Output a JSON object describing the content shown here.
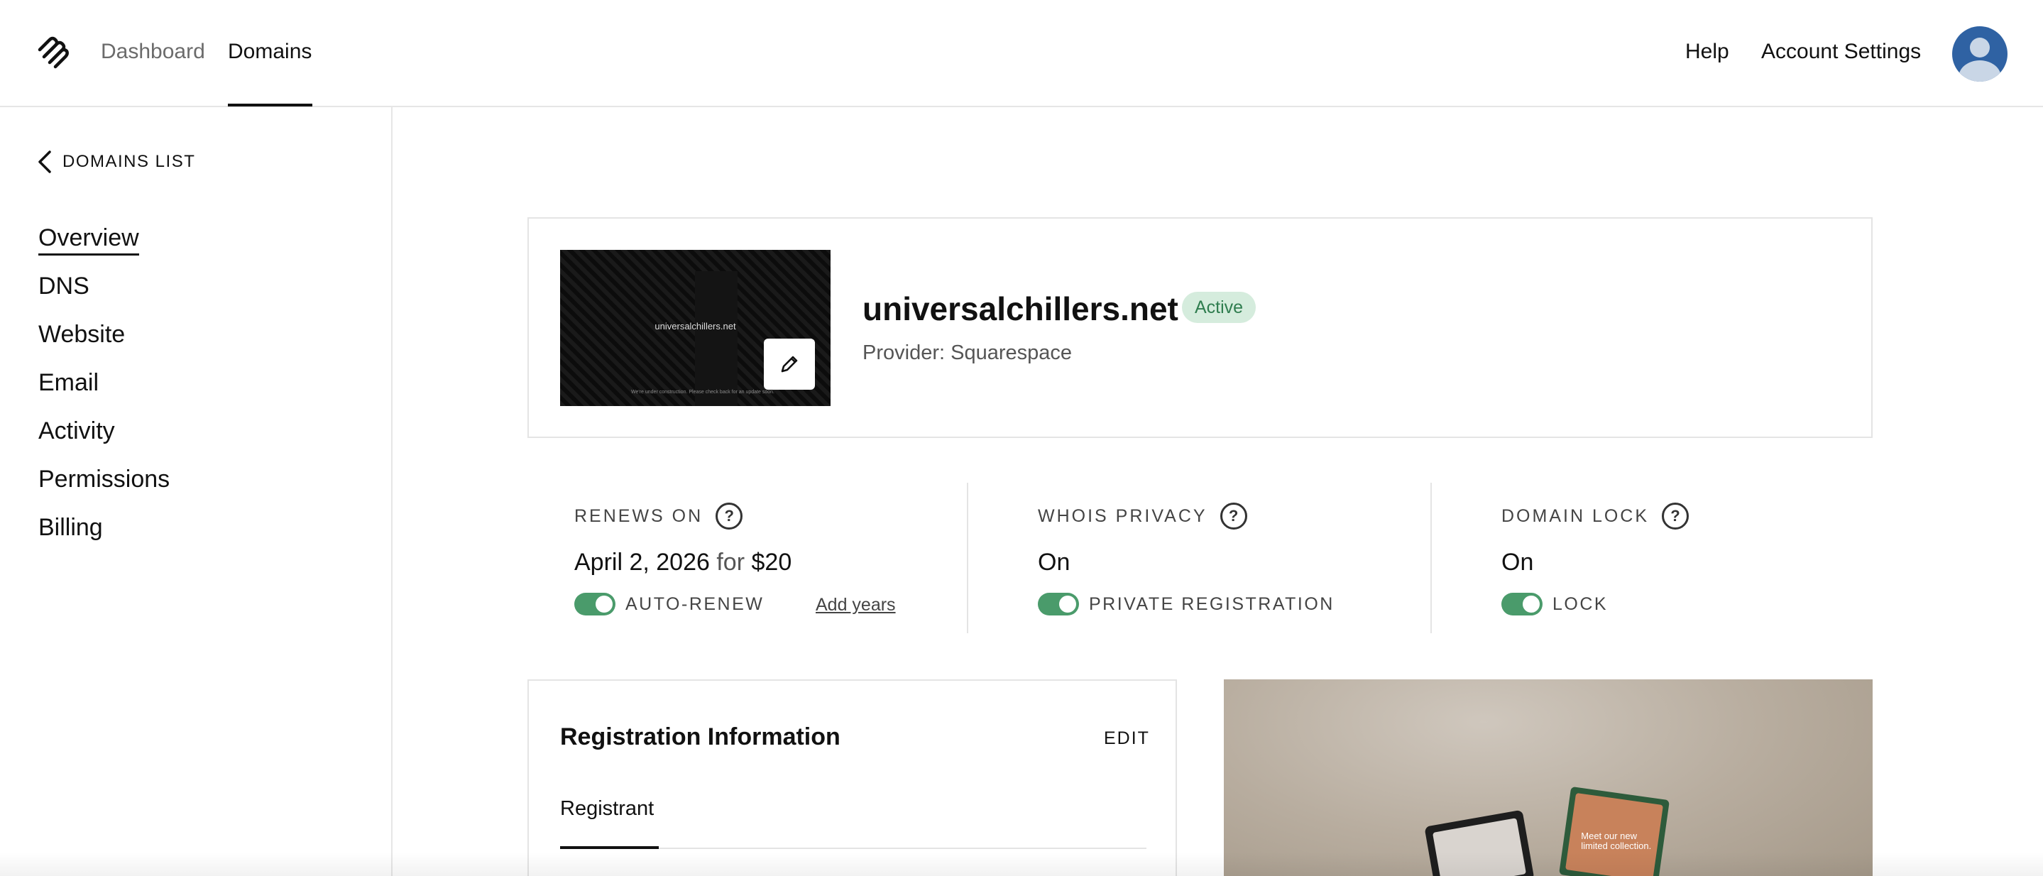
{
  "nav": {
    "logo": "squarespace-logo",
    "links": [
      {
        "label": "Dashboard",
        "active": false
      },
      {
        "label": "Domains",
        "active": true
      }
    ],
    "right_links": [
      "Help",
      "Account Settings"
    ],
    "avatar": "user-avatar"
  },
  "sidebar": {
    "back_label": "DOMAINS LIST",
    "items": [
      {
        "label": "Overview",
        "active": true
      },
      {
        "label": "DNS"
      },
      {
        "label": "Website"
      },
      {
        "label": "Email"
      },
      {
        "label": "Activity"
      },
      {
        "label": "Permissions"
      },
      {
        "label": "Billing"
      }
    ]
  },
  "domain": {
    "name": "universalchillers.net",
    "status": "Active",
    "provider": "Provider: Squarespace",
    "thumbnail_text": "universalchillers.net",
    "thumbnail_footer": "We're under construction. Please check back for an update soon.",
    "colors": {
      "status_bg": "#d5ecdd",
      "status_text": "#2f7d4f",
      "toggle_on": "#4a9b6b"
    }
  },
  "info": {
    "renews": {
      "label": "RENEWS ON",
      "date": "April 2, 2026",
      "for": "for",
      "price": "$20",
      "toggle_label": "AUTO-RENEW",
      "toggle_on": true,
      "add_years": "Add years"
    },
    "whois": {
      "label": "WHOIS PRIVACY",
      "value": "On",
      "toggle_label": "PRIVATE REGISTRATION",
      "toggle_on": true
    },
    "lock": {
      "label": "DOMAIN LOCK",
      "value": "On",
      "toggle_label": "LOCK",
      "toggle_on": true
    }
  },
  "registration": {
    "title": "Registration Information",
    "edit_label": "EDIT",
    "tabs": [
      "Registrant"
    ]
  },
  "promo": {
    "tablet_text": "Meet our new limited collection."
  }
}
